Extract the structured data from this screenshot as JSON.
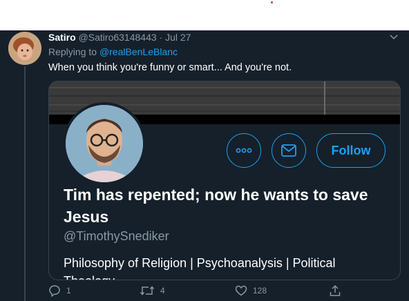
{
  "tweet": {
    "display_name": "Satiro",
    "handle_date": "@Satiro63148443 · Jul 27",
    "replying_prefix": "Replying to",
    "replying_to": "@realBenLeBlanc",
    "text": "When you think you're funny or smart... And you're not."
  },
  "card": {
    "name": "Tim has repented; now he wants to save Jesus",
    "handle": "@TimothySnediker",
    "bio": "Philosophy of Religion | Psychoanalysis | Political Theology",
    "follow_label": "Follow"
  },
  "actions": {
    "reply_count": "1",
    "retweet_count": "4",
    "like_count": "128"
  },
  "colors": {
    "background": "#15202b",
    "accent": "#1da1f2",
    "muted": "#8899a6",
    "border": "#38444d"
  },
  "icons": [
    "chevron-down-icon",
    "more-icon",
    "mail-icon",
    "reply-icon",
    "retweet-icon",
    "like-icon",
    "share-icon"
  ]
}
